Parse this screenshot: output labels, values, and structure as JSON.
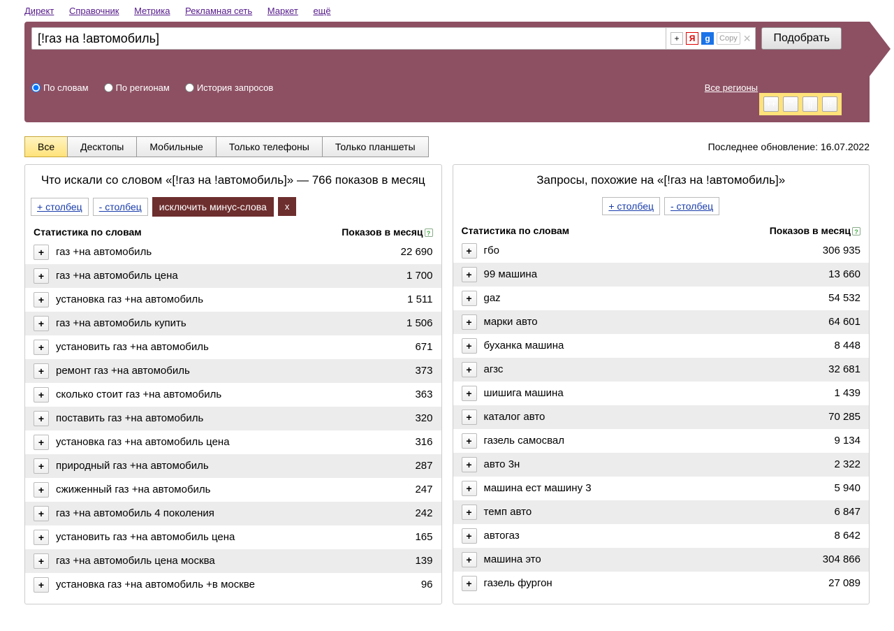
{
  "top_links": [
    "Директ",
    "Справочник",
    "Метрика",
    "Рекламная сеть",
    "Маркет",
    "ещё"
  ],
  "search": {
    "value": "[!газ на !автомобиль]",
    "copy": "Copy",
    "submit": "Подобрать"
  },
  "radios": {
    "words": "По словам",
    "regions": "По регионам",
    "history": "История запросов"
  },
  "region_label": "Все регионы",
  "tools": [
    "++",
    "'''",
    "||",
    "!!"
  ],
  "tabs": [
    "Все",
    "Десктопы",
    "Мобильные",
    "Только телефоны",
    "Только планшеты"
  ],
  "updated": "Последнее обновление: 16.07.2022",
  "left": {
    "title": "Что искали со словом «[!газ на !автомобиль]» — 766 показов в месяц",
    "add_col": "+ столбец",
    "rem_col": "- столбец",
    "exclude": "исключить минус-слова",
    "x": "x",
    "h1": "Статистика по словам",
    "h2": "Показов в месяц",
    "rows": [
      {
        "t": "газ +на автомобиль",
        "v": "22 690"
      },
      {
        "t": "газ +на автомобиль цена",
        "v": "1 700"
      },
      {
        "t": "установка газ +на автомобиль",
        "v": "1 511"
      },
      {
        "t": "газ +на автомобиль купить",
        "v": "1 506"
      },
      {
        "t": "установить газ +на автомобиль",
        "v": "671"
      },
      {
        "t": "ремонт газ +на автомобиль",
        "v": "373"
      },
      {
        "t": "сколько стоит газ +на автомобиль",
        "v": "363"
      },
      {
        "t": "поставить газ +на автомобиль",
        "v": "320"
      },
      {
        "t": "установка газ +на автомобиль цена",
        "v": "316"
      },
      {
        "t": "природный газ +на автомобиль",
        "v": "287"
      },
      {
        "t": "сжиженный газ +на автомобиль",
        "v": "247"
      },
      {
        "t": "газ +на автомобиль 4 поколения",
        "v": "242"
      },
      {
        "t": "установить газ +на автомобиль цена",
        "v": "165"
      },
      {
        "t": "газ +на автомобиль цена москва",
        "v": "139"
      },
      {
        "t": "установка газ +на автомобиль +в москве",
        "v": "96"
      }
    ]
  },
  "right": {
    "title": "Запросы, похожие на «[!газ на !автомобиль]»",
    "add_col": "+ столбец",
    "rem_col": "- столбец",
    "h1": "Статистика по словам",
    "h2": "Показов в месяц",
    "rows": [
      {
        "t": "гбо",
        "v": "306 935"
      },
      {
        "t": "99 машина",
        "v": "13 660"
      },
      {
        "t": "gaz",
        "v": "54 532"
      },
      {
        "t": "марки авто",
        "v": "64 601"
      },
      {
        "t": "буханка машина",
        "v": "8 448"
      },
      {
        "t": "агзс",
        "v": "32 681"
      },
      {
        "t": "шишига машина",
        "v": "1 439"
      },
      {
        "t": "каталог авто",
        "v": "70 285"
      },
      {
        "t": "газель самосвал",
        "v": "9 134"
      },
      {
        "t": "авто 3н",
        "v": "2 322"
      },
      {
        "t": "машина ест машину 3",
        "v": "5 940"
      },
      {
        "t": "темп авто",
        "v": "6 847"
      },
      {
        "t": "автогаз",
        "v": "8 642"
      },
      {
        "t": "машина это",
        "v": "304 866"
      },
      {
        "t": "газель фургон",
        "v": "27 089"
      }
    ]
  }
}
